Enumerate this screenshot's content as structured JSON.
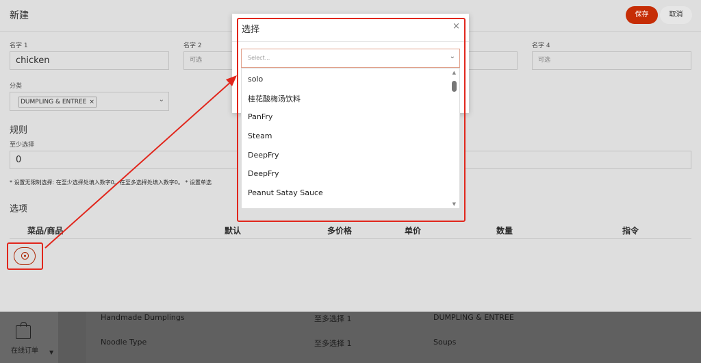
{
  "header": {
    "title": "新建",
    "save_label": "保存",
    "cancel_label": "取消"
  },
  "form": {
    "name1": {
      "label": "名字 1",
      "value": "chicken"
    },
    "name2": {
      "label": "名字 2",
      "placeholder": "可选"
    },
    "name3": {
      "placeholder": "可选"
    },
    "name4": {
      "label": "名字 4",
      "placeholder": "可选"
    },
    "category": {
      "label": "分类",
      "tag": "DUMPLING & ENTREE",
      "tag_remove": "×"
    }
  },
  "rules": {
    "title": "规则",
    "min_label": "至少选择",
    "min_value": "0",
    "note": "* 设置无限制选择: 在至少选择处填入数字0。在至多选择处填入数字0。 * 设置单选"
  },
  "options": {
    "title": "选项",
    "columns": [
      "菜品/商品",
      "默认",
      "多价格",
      "单价",
      "数量",
      "指令"
    ]
  },
  "modal": {
    "title": "选择",
    "close": "×",
    "select_placeholder": "Select...",
    "items": [
      "solo",
      "桂花酸梅汤饮料",
      "PanFry",
      "Steam",
      "DeepFry",
      "DeepFry",
      "Peanut Satay Sauce"
    ]
  },
  "bottom": {
    "nav_label": "在线订单",
    "rows": [
      {
        "name": "Handmade Dumplings",
        "rule": "至多选择 1",
        "category": "DUMPLING & ENTREE"
      },
      {
        "name": "Noodle Type",
        "rule": "至多选择 1",
        "category": "Soups"
      }
    ]
  },
  "colors": {
    "accent": "#c62d06",
    "highlight": "#e1261c"
  }
}
